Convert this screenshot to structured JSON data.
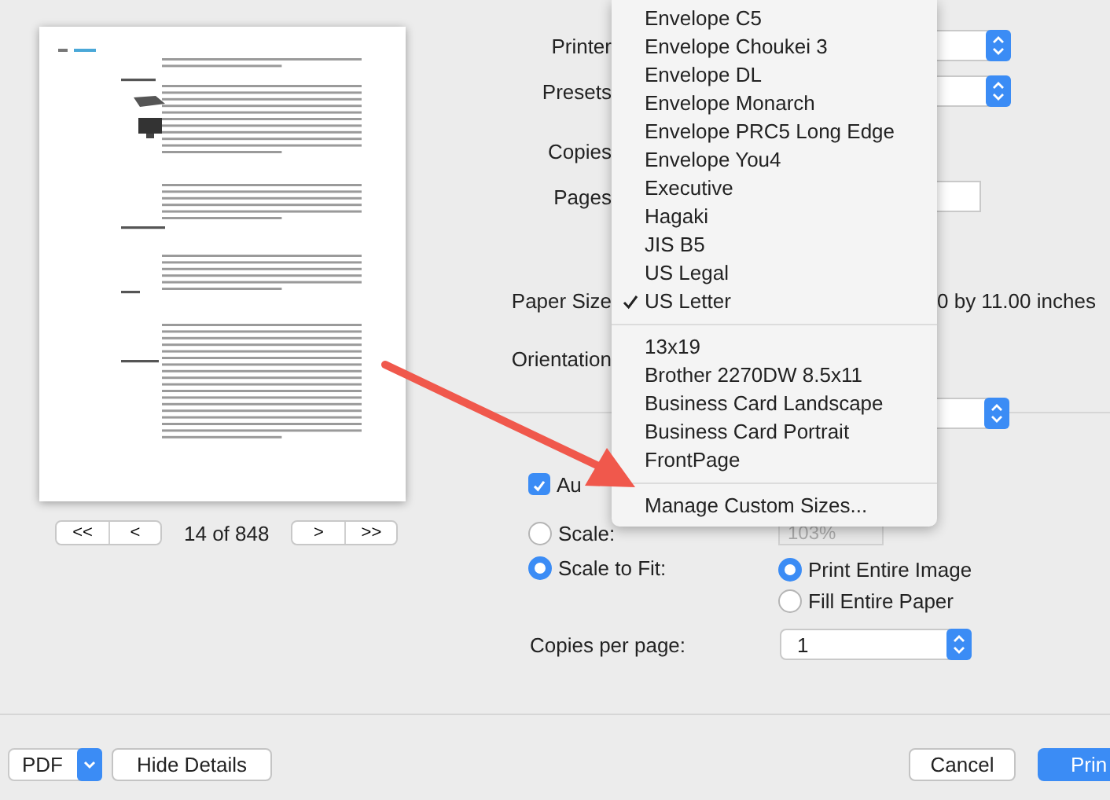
{
  "preview": {
    "nav_back": [
      "<<",
      "<"
    ],
    "page_counter": "14 of 848",
    "nav_forward": [
      ">",
      ">>"
    ]
  },
  "fields": [
    {
      "label": "Printer",
      "kind": "select"
    },
    {
      "label": "Presets",
      "kind": "select"
    },
    {
      "label": "Copies",
      "kind": "covered"
    },
    {
      "label": "Pages",
      "kind": "field"
    },
    {
      "label": "Paper Size",
      "kind": "text",
      "value": "0 by 11.00 inches"
    },
    {
      "label": "Orientation",
      "kind": "covered"
    }
  ],
  "app_options": {
    "auto_rotate": {
      "label": "Au",
      "checked": true
    },
    "scale": {
      "label": "Scale:",
      "selected": false,
      "value": "103%",
      "disabled": true
    },
    "scale_to_fit": {
      "label": "Scale to Fit:",
      "selected": true
    },
    "fit_options": [
      {
        "label": "Print Entire Image",
        "selected": true
      },
      {
        "label": "Fill Entire Paper",
        "selected": false
      }
    ],
    "copies_per_page": {
      "label": "Copies per page:",
      "value": "1"
    }
  },
  "menu": {
    "groups": [
      [
        {
          "label": "Envelope C5",
          "checked": false
        },
        {
          "label": "Envelope Choukei 3",
          "checked": false
        },
        {
          "label": "Envelope DL",
          "checked": false
        },
        {
          "label": "Envelope Monarch",
          "checked": false
        },
        {
          "label": "Envelope PRC5 Long Edge",
          "checked": false
        },
        {
          "label": "Envelope You4",
          "checked": false
        },
        {
          "label": "Executive",
          "checked": false
        },
        {
          "label": "Hagaki",
          "checked": false
        },
        {
          "label": "JIS B5",
          "checked": false
        },
        {
          "label": "US Legal",
          "checked": false
        },
        {
          "label": "US Letter",
          "checked": true
        }
      ],
      [
        {
          "label": "13x19",
          "checked": false
        },
        {
          "label": "Brother 2270DW 8.5x11",
          "checked": false
        },
        {
          "label": "Business Card Landscape",
          "checked": false
        },
        {
          "label": "Business Card Portrait",
          "checked": false
        },
        {
          "label": "FrontPage",
          "checked": false
        }
      ],
      [
        {
          "label": "Manage Custom Sizes...",
          "checked": false
        }
      ]
    ]
  },
  "footer": {
    "pdf_button": "PDF",
    "hide_details_button": "Hide Details",
    "cancel_button": "Cancel",
    "print_button": "Prin"
  }
}
